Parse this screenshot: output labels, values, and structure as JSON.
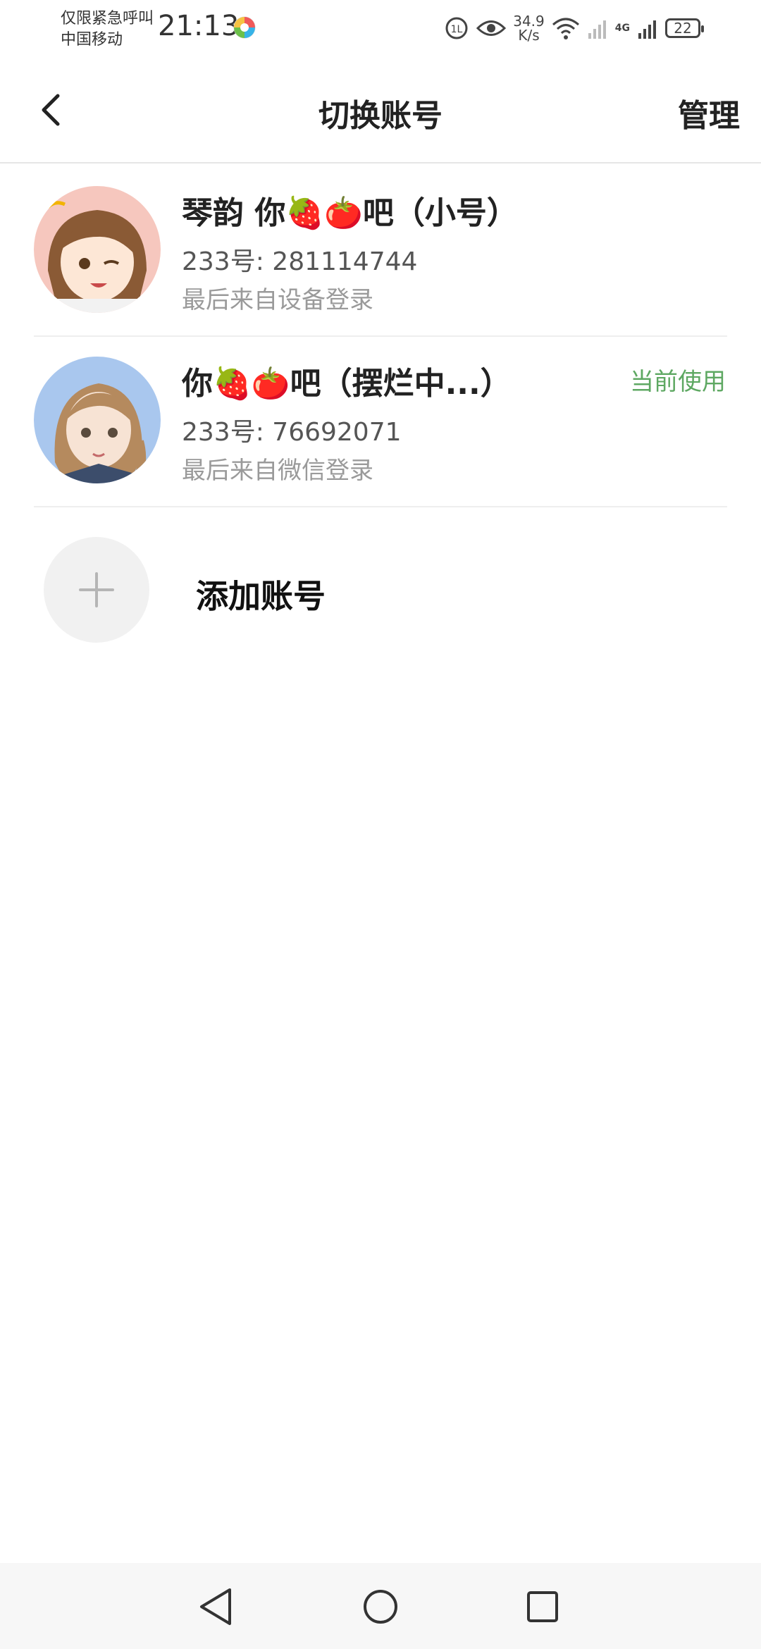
{
  "status_bar": {
    "emergency": "仅限紧急呼叫",
    "carrier": "中国移动",
    "time": "21:13",
    "speed_value": "34.9",
    "speed_unit": "K/s",
    "network": "4G",
    "battery": "22"
  },
  "header": {
    "title": "切换账号",
    "manage_label": "管理"
  },
  "accounts": [
    {
      "name": "琴韵  你🍓🍅吧（小号）",
      "uid": "233号: 281114744",
      "last_login": "最后来自设备登录",
      "badge": ""
    },
    {
      "name": "你🍓🍅吧（摆烂中...）",
      "uid": "233号: 76692071",
      "last_login": "最后来自微信登录",
      "badge": "当前使用"
    }
  ],
  "add_account": {
    "label": "添加账号"
  },
  "colors": {
    "accent_green": "#5ea862",
    "divider": "#eeeeee"
  },
  "icons": [
    "back-icon",
    "plus-icon",
    "nav-back-icon",
    "nav-home-icon",
    "nav-recents-icon",
    "wifi-icon",
    "signal-icon",
    "eye-icon"
  ]
}
